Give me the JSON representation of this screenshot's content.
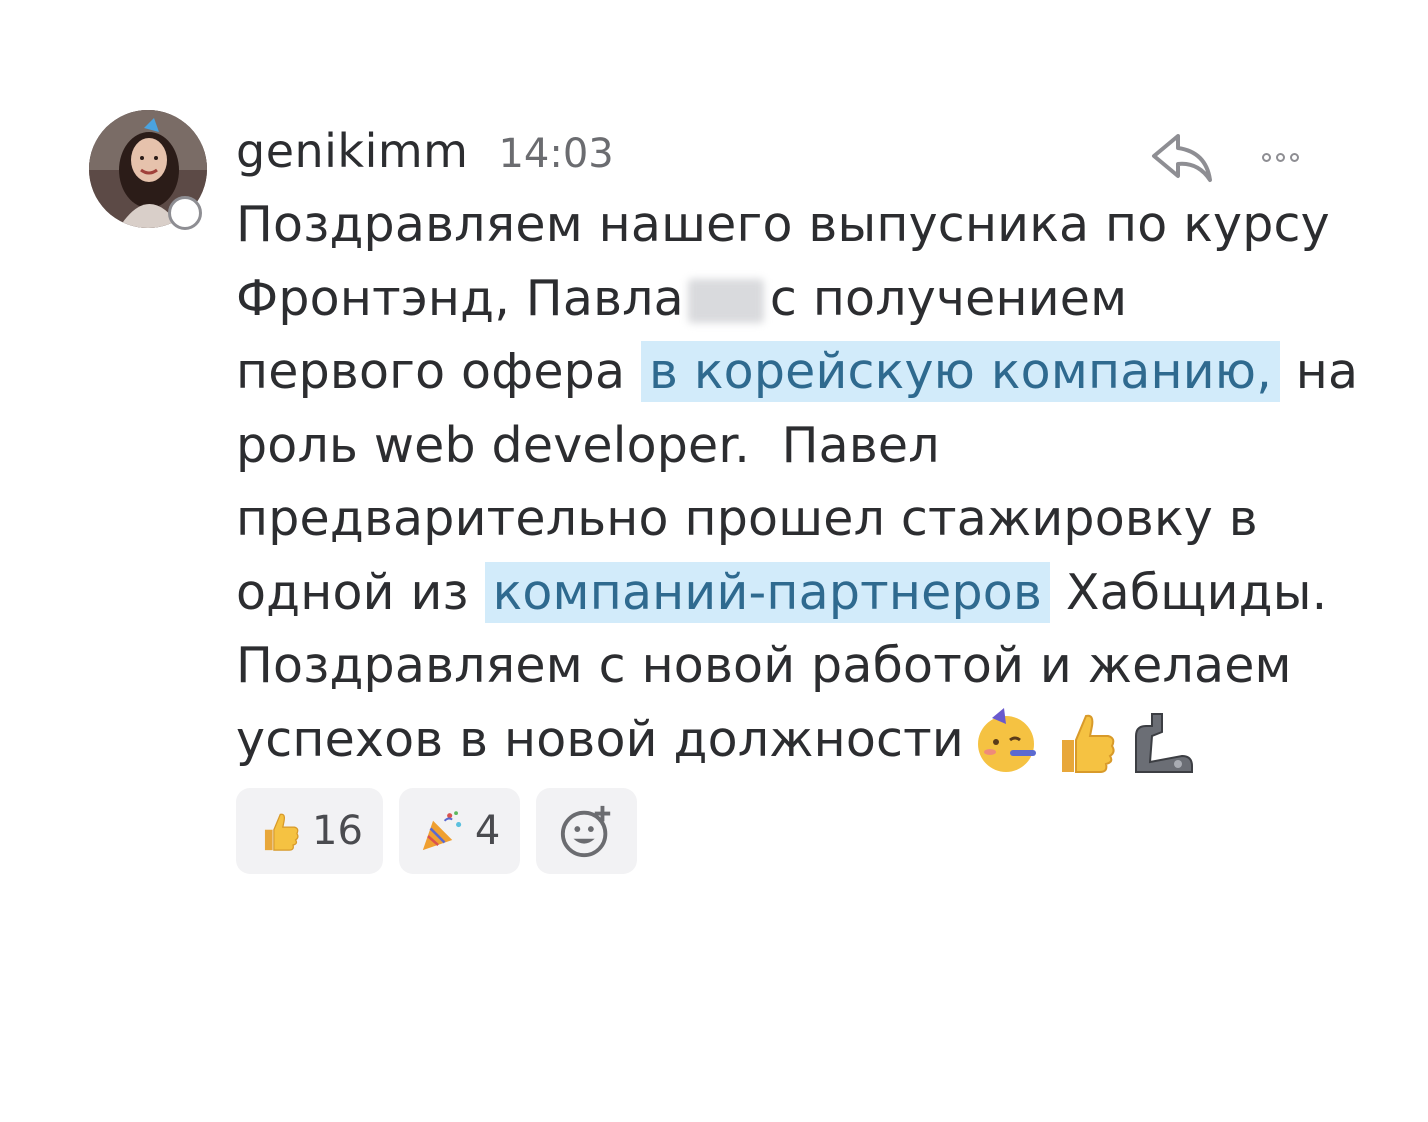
{
  "message": {
    "username": "genikimm",
    "timestamp": "14:03",
    "lines": [
      [
        "Поздравляем нашего выпусника по курсу"
      ],
      [
        "Фронтэнд, Павла",
        "с получением"
      ],
      [
        "первого офера",
        "в корейскую компанию,",
        "на"
      ],
      [
        "роль web developer.  Павел"
      ],
      [
        "предварительно прошел стажировку в"
      ],
      [
        "одной из",
        "компаний-партнеров",
        "Хабщиды."
      ],
      [
        "Поздравляем с новой работой и желаем"
      ],
      [
        "успехов в новой должности"
      ]
    ],
    "inline_emojis": [
      "partying-face-icon",
      "thumbs-up-icon",
      "mechanical-arm-icon"
    ]
  },
  "reactions": [
    {
      "icon": "thumbs-up-icon",
      "count": "16"
    },
    {
      "icon": "party-popper-icon",
      "count": "4"
    }
  ],
  "actions": {
    "reply_icon": "reply-icon",
    "more_icon": "more-icon",
    "add_reaction_icon": "add-reaction-icon"
  },
  "colors": {
    "highlight_bg": "#d2ebfa",
    "highlight_text": "#2f6a8f",
    "reaction_bg": "#f2f2f4"
  }
}
